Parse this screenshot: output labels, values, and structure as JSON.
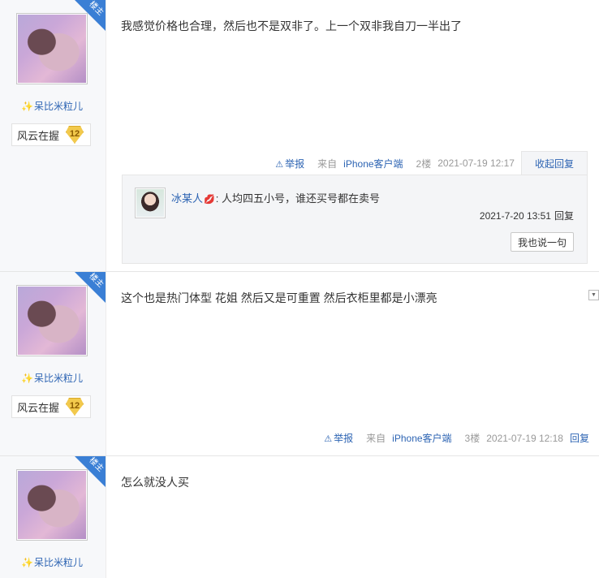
{
  "posts": [
    {
      "author": "呆比米粒儿",
      "level_title": "风云在握",
      "level_num": "12",
      "lz_badge": "楼主",
      "content": "我感觉价格也合理，然后也不是双非了。上一个双非我自刀一半出了",
      "report": "举报",
      "client_prefix": "来自",
      "client_name": "iPhone客户端",
      "floor": "2楼",
      "time": "2021-07-19 12:17",
      "reply_action": "收起回复",
      "sub_replies": [
        {
          "name": "冰某人",
          "text": ": 人均四五小号，谁还买号都在卖号",
          "time": "2021-7-20 13:51",
          "reply": "回复"
        }
      ],
      "say_button": "我也说一句"
    },
    {
      "author": "呆比米粒儿",
      "level_title": "风云在握",
      "level_num": "12",
      "lz_badge": "楼主",
      "content": "这个也是热门体型 花姐 然后又是可重置 然后衣柜里都是小漂亮",
      "report": "举报",
      "client_prefix": "来自",
      "client_name": "iPhone客户端",
      "floor": "3楼",
      "time": "2021-07-19 12:18",
      "reply_action": "回复"
    },
    {
      "author": "呆比米粒儿",
      "lz_badge": "楼主",
      "content": "怎么就没人买"
    }
  ],
  "icons": {
    "sparkle": "✨",
    "report": "⚠",
    "lips": "💋",
    "dropdown": "▼"
  }
}
